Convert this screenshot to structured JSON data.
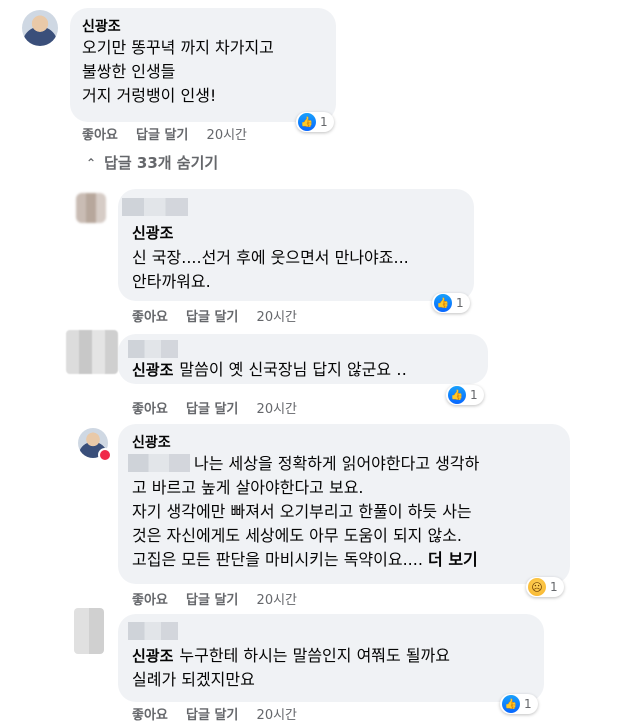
{
  "top_comment": {
    "author": "신광조",
    "lines": [
      "오기만 똥꾸녁 까지 차가지고",
      "불쌍한 인생들",
      "거지 거렁뱅이 인생!"
    ],
    "like_label": "좋아요",
    "reply_label": "답글 달기",
    "time": "20시간",
    "reaction_count": "1"
  },
  "hide_replies": {
    "label": "답글 33개 숨기기"
  },
  "replies": [
    {
      "author": "신광조",
      "lines": [
        "신 국장....선거 후에 웃으면서 만나야죠...",
        "안타까워요."
      ],
      "like_label": "좋아요",
      "reply_label": "답글 달기",
      "time": "20시간",
      "reaction_count": "1"
    },
    {
      "author": "신광조",
      "text": "말씀이 옛 신국장님 답지 않군요 ‥",
      "like_label": "좋아요",
      "reply_label": "답글 달기",
      "time": "20시간",
      "reaction_count": "1"
    },
    {
      "author": "신광조",
      "lines": [
        "나는 세상을 정확하게 읽어야한다고 생각하",
        "고 바르고 높게 살아야한다고 보요.",
        "자기 생각에만 빠져서 오기부리고 한풀이 하듯 사는",
        "것은 자신에게도 세상에도 아무 도움이 되지 않소.",
        "고집은 모든 판단을 마비시키는 독약이요...."
      ],
      "see_more": "더 보기",
      "like_label": "좋아요",
      "reply_label": "답글 달기",
      "time": "20시간",
      "reaction_count": "1"
    },
    {
      "author": "신광조",
      "lines": [
        "누구한테 하시는 말씀인지 여쭤도 될까요",
        "실례가 되겠지만요"
      ],
      "like_label": "좋아요",
      "reply_label": "답글 달기",
      "time": "20시간",
      "reaction_count": "1"
    }
  ]
}
